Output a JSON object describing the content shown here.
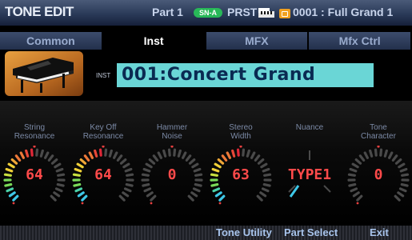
{
  "header": {
    "title": "TONE EDIT",
    "part": "Part 1",
    "badge": "SN-A",
    "prst": "PRST",
    "tone": "0001 : Full Grand 1"
  },
  "tabs": [
    {
      "label": "Common"
    },
    {
      "label": "Inst"
    },
    {
      "label": "MFX"
    },
    {
      "label": "Mfx Ctrl"
    }
  ],
  "inst": {
    "tag": "INST",
    "name": "001:Concert Grand"
  },
  "knobs": [
    {
      "label": "String\nResonance",
      "value": "64",
      "level": 0.5,
      "colored": true
    },
    {
      "label": "Key Off\nResonance",
      "value": "64",
      "level": 0.5,
      "colored": true
    },
    {
      "label": "Hammer\nNoise",
      "value": "0",
      "level": 0.0,
      "colored": false
    },
    {
      "label": "Stereo\nWidth",
      "value": "63",
      "level": 0.5,
      "colored": true
    },
    {
      "label": "Nuance",
      "value": "TYPE1",
      "level": 0.0,
      "colored": false,
      "selector": true
    },
    {
      "label": "Tone\nCharacter",
      "value": "0",
      "level": 0.0,
      "colored": false
    }
  ],
  "footer": {
    "tone_utility": "Tone Utility",
    "part_select": "Part Select",
    "exit": "Exit"
  },
  "colors": {
    "accent": "#6ad6d6",
    "value": "#ff4a4a"
  }
}
